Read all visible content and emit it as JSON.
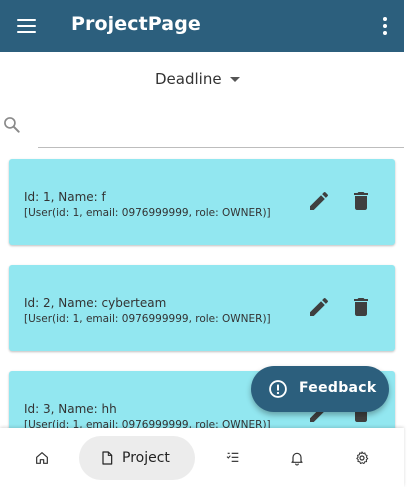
{
  "app_bar": {
    "title": "ProjectPage",
    "menu_icon": "menu-icon",
    "more_icon": "more-vert-icon",
    "color": "#2c5f7d"
  },
  "sort": {
    "label": "Deadline"
  },
  "search": {
    "value": "",
    "placeholder": ""
  },
  "projects": [
    {
      "name_line": "Id: 1, Name: f",
      "users_line": "[User(id: 1, email: 0976999999, role: OWNER)]"
    },
    {
      "name_line": "Id: 2, Name: cyberteam",
      "users_line": "[User(id: 1, email: 0976999999, role: OWNER)]"
    },
    {
      "name_line": "Id: 3, Name: hh",
      "users_line": "[User(id: 1, email: 0976999999, role: OWNER)]"
    }
  ],
  "card_color": "#92e7f0",
  "feedback": {
    "label": "Feedback"
  },
  "bottom_nav": {
    "items": [
      {
        "icon": "home-icon",
        "label": ""
      },
      {
        "icon": "project-document-icon",
        "label": "Project",
        "active": true
      },
      {
        "icon": "task-list-icon",
        "label": ""
      },
      {
        "icon": "bell-icon",
        "label": ""
      },
      {
        "icon": "gear-icon",
        "label": ""
      }
    ]
  }
}
